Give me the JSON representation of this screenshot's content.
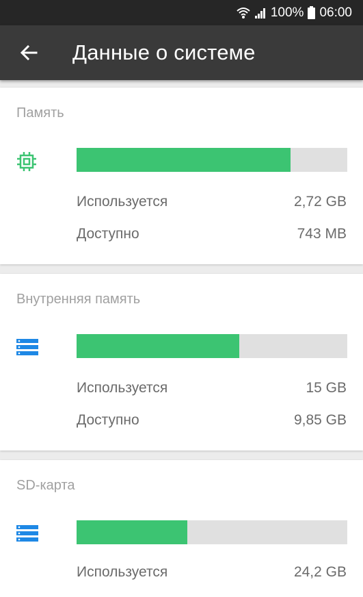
{
  "status_bar": {
    "battery": "100%",
    "time": "06:00",
    "icons": [
      "wifi-icon",
      "signal-icon",
      "battery-icon"
    ]
  },
  "app_bar": {
    "title": "Данные о системе",
    "back_icon": "arrow-back-icon"
  },
  "colors": {
    "bar_fill": "#3cc472",
    "bar_track": "#e0e0e0",
    "cpu_icon": "#3cc472",
    "storage_icon": "#1e88e5"
  },
  "cards": [
    {
      "title": "Память",
      "icon": "chip-icon",
      "used_fraction": 0.79,
      "used_label": "Используется",
      "used_value": "2,72 GB",
      "available_label": "Доступно",
      "available_value": "743 MB"
    },
    {
      "title": "Внутренняя память",
      "icon": "storage-icon",
      "used_fraction": 0.6,
      "used_label": "Используется",
      "used_value": "15 GB",
      "available_label": "Доступно",
      "available_value": "9,85 GB"
    },
    {
      "title": "SD-карта",
      "icon": "storage-icon",
      "used_fraction": 0.41,
      "used_label": "Используется",
      "used_value": "24,2 GB"
    }
  ]
}
